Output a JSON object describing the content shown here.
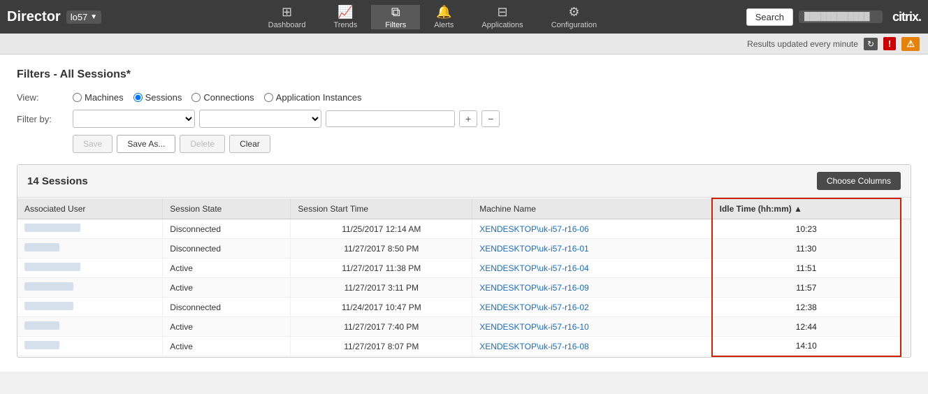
{
  "brand": {
    "title": "Director",
    "site": "lo57",
    "citrix": "citrix."
  },
  "nav": {
    "items": [
      {
        "label": "Dashboard",
        "icon": "⊞",
        "active": false
      },
      {
        "label": "Trends",
        "icon": "📊",
        "active": false
      },
      {
        "label": "Filters",
        "icon": "⧉",
        "active": true
      },
      {
        "label": "Alerts",
        "icon": "🔔",
        "active": false
      },
      {
        "label": "Applications",
        "icon": "⊟",
        "active": false
      },
      {
        "label": "Configuration",
        "icon": "⚙",
        "active": false
      }
    ],
    "search_label": "Search"
  },
  "statusbar": {
    "text": "Results updated every minute",
    "refresh_label": "↻"
  },
  "filters_page": {
    "title": "Filters - All Sessions*",
    "view_label": "View:",
    "view_options": [
      "Machines",
      "Sessions",
      "Connections",
      "Application Instances"
    ],
    "view_selected": "Sessions",
    "filter_label": "Filter by:",
    "button_save": "Save",
    "button_saveas": "Save As...",
    "button_delete": "Delete",
    "button_clear": "Clear"
  },
  "table": {
    "count_label": "14 Sessions",
    "choose_columns": "Choose Columns",
    "columns": [
      {
        "label": "Associated User",
        "key": "user"
      },
      {
        "label": "Session State",
        "key": "state"
      },
      {
        "label": "Session Start Time",
        "key": "start_time"
      },
      {
        "label": "Machine Name",
        "key": "machine"
      },
      {
        "label": "Idle Time (hh:mm) ▲",
        "key": "idle_time",
        "sorted": true
      }
    ],
    "rows": [
      {
        "user_blur": "long",
        "state": "Disconnected",
        "start_time": "11/25/2017 12:14 AM",
        "machine": "XENDESKTOP\\uk-i57-r16-06",
        "idle_time": "10:23"
      },
      {
        "user_blur": "short",
        "state": "Disconnected",
        "start_time": "11/27/2017 8:50 PM",
        "machine": "XENDESKTOP\\uk-i57-r16-01",
        "idle_time": "11:30"
      },
      {
        "user_blur": "long",
        "state": "Active",
        "start_time": "11/27/2017 11:38 PM",
        "machine": "XENDESKTOP\\uk-i57-r16-04",
        "idle_time": "11:51"
      },
      {
        "user_blur": "medium",
        "state": "Active",
        "start_time": "11/27/2017 3:11 PM",
        "machine": "XENDESKTOP\\uk-i57-r16-09",
        "idle_time": "11:57"
      },
      {
        "user_blur": "medium",
        "state": "Disconnected",
        "start_time": "11/24/2017 10:47 PM",
        "machine": "XENDESKTOP\\uk-i57-r16-02",
        "idle_time": "12:38"
      },
      {
        "user_blur": "short",
        "state": "Active",
        "start_time": "11/27/2017 7:40 PM",
        "machine": "XENDESKTOP\\uk-i57-r16-10",
        "idle_time": "12:44"
      },
      {
        "user_blur": "short",
        "state": "Active",
        "start_time": "11/27/2017 8:07 PM",
        "machine": "XENDESKTOP\\uk-i57-r16-08",
        "idle_time": "14:10"
      }
    ]
  }
}
